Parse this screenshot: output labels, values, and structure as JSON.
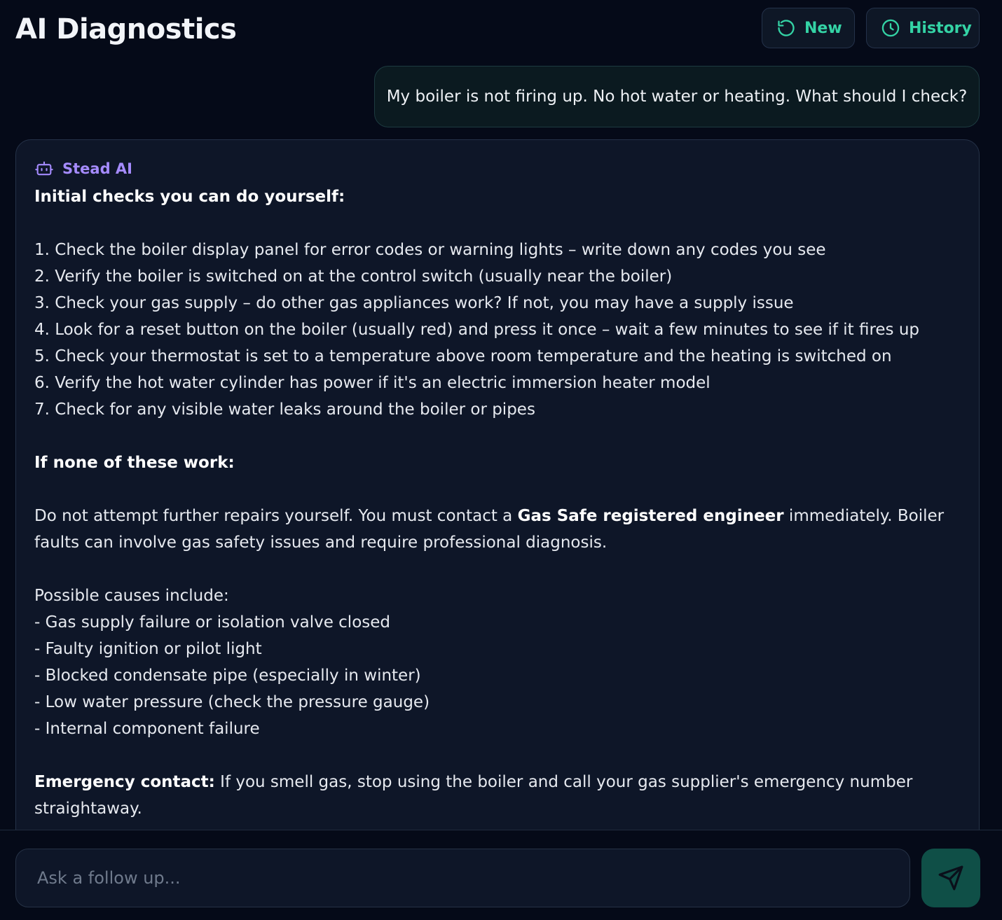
{
  "header": {
    "title": "AI Diagnostics",
    "new_label": "New",
    "history_label": "History"
  },
  "conversation": {
    "user_message": "My boiler is not firing up. No hot water or heating. What should I check?",
    "assistant_name": "Stead AI",
    "response": {
      "heading_1": "Initial checks you can do yourself:",
      "checks": [
        "1. Check the boiler display panel for error codes or warning lights – write down any codes you see",
        "2. Verify the boiler is switched on at the control switch (usually near the boiler)",
        "3. Check your gas supply – do other gas appliances work? If not, you may have a supply issue",
        "4. Look for a reset button on the boiler (usually red) and press it once – wait a few minutes to see if it fires up",
        "5. Check your thermostat is set to a temperature above room temperature and the heating is switched on",
        "6. Verify the hot water cylinder has power if it's an electric immersion heater model",
        "7. Check for any visible water leaks around the boiler or pipes"
      ],
      "heading_2": "If none of these work:",
      "advice_pre": "Do not attempt further repairs yourself. You must contact a ",
      "advice_bold": "Gas Safe registered engineer",
      "advice_post": " immediately. Boiler faults can involve gas safety issues and require professional diagnosis.",
      "causes_intro": "Possible causes include:",
      "causes": [
        "- Gas supply failure or isolation valve closed",
        "- Faulty ignition or pilot light",
        "- Blocked condensate pipe (especially in winter)",
        "- Low water pressure (check the pressure gauge)",
        "- Internal component failure"
      ],
      "emergency_label": "Emergency contact:",
      "emergency_text": " If you smell gas, stop using the boiler and call your gas supplier's emergency number straightaway."
    }
  },
  "composer": {
    "placeholder": "Ask a follow up..."
  },
  "icons": {
    "new": "refresh-icon",
    "history": "clock-icon",
    "assistant": "bot-icon",
    "send": "send-icon"
  },
  "colors": {
    "background": "#050a18",
    "card": "#0e1628",
    "accent_green": "#34d3a5",
    "accent_purple": "#a58bff",
    "send_button": "#0f4f47"
  }
}
